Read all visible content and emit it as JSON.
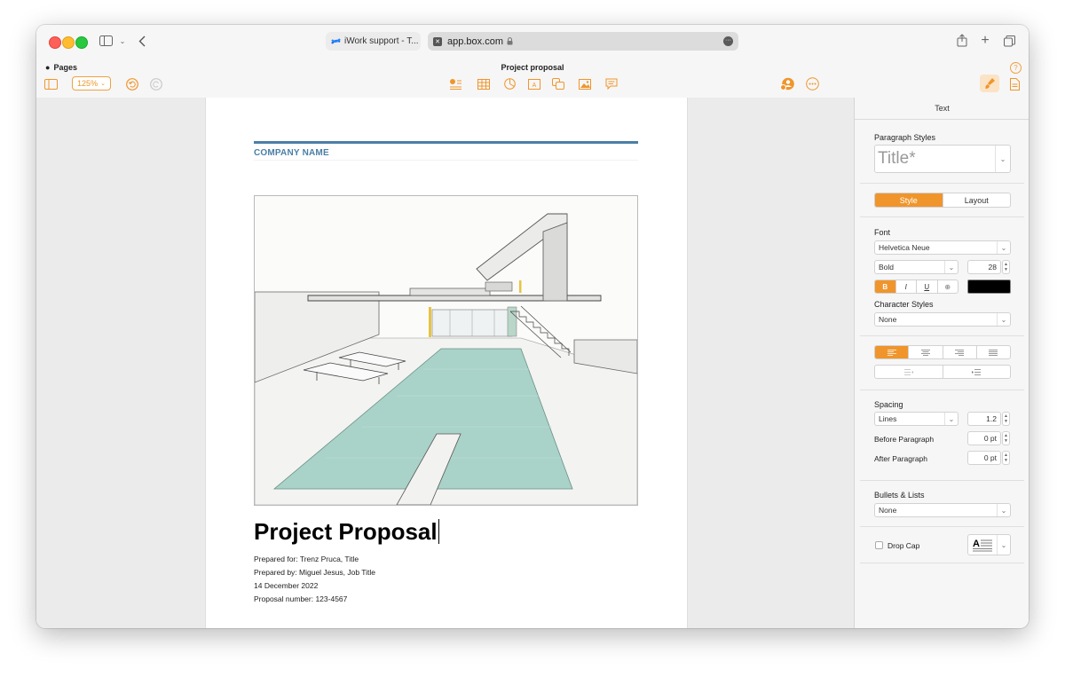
{
  "browser": {
    "tab_inactive_label": "iWork support - T...",
    "address": "app.box.com"
  },
  "app": {
    "name": "Pages",
    "document_title": "Project proposal",
    "zoom": "125%"
  },
  "document": {
    "company_name": "COMPANY NAME",
    "title": "Project Proposal",
    "meta_lines": [
      "Prepared for: Trenz Pruca, Title",
      "Prepared by: Miguel Jesus, Job Title",
      "14 December 2022",
      "Proposal number: 123-4567"
    ]
  },
  "inspector": {
    "header": "Text",
    "paragraph_styles_label": "Paragraph Styles",
    "paragraph_style_value": "Title*",
    "tabs": [
      "Style",
      "Layout"
    ],
    "active_tab": "Style",
    "font_label": "Font",
    "font_family": "Helvetica Neue",
    "font_weight": "Bold",
    "font_size": "28",
    "format_buttons": [
      "B",
      "I",
      "U",
      "⊕"
    ],
    "text_color": "#000000",
    "character_styles_label": "Character Styles",
    "character_style_value": "None",
    "spacing_label": "Spacing",
    "spacing_mode": "Lines",
    "spacing_value": "1.2",
    "before_paragraph_label": "Before Paragraph",
    "before_paragraph_value": "0 pt",
    "after_paragraph_label": "After Paragraph",
    "after_paragraph_value": "0 pt",
    "bullets_label": "Bullets & Lists",
    "bullets_value": "None",
    "drop_cap_label": "Drop Cap",
    "drop_cap_checked": false
  },
  "colors": {
    "accent": "#f0952b",
    "company": "#4a7fa7",
    "pool": "#a9d2c8"
  }
}
